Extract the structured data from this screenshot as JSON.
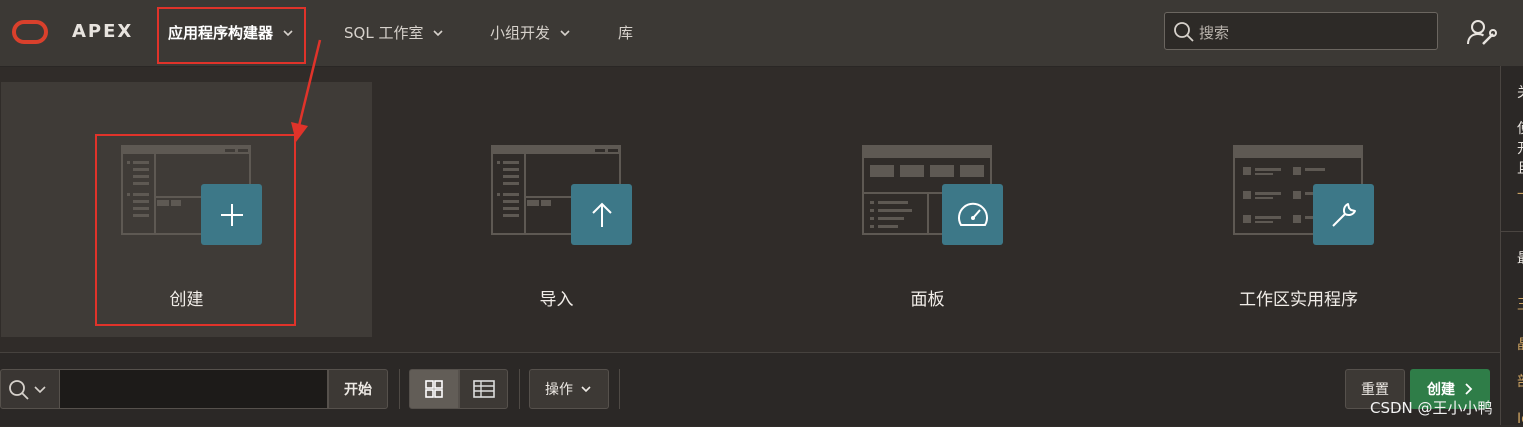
{
  "header": {
    "brand": "APEX",
    "nav": [
      {
        "label": "应用程序构建器",
        "active": true,
        "has_menu": true
      },
      {
        "label": "SQL 工作室",
        "active": false,
        "has_menu": true
      },
      {
        "label": "小组开发",
        "active": false,
        "has_menu": true
      },
      {
        "label": "库",
        "active": false,
        "has_menu": false
      }
    ],
    "search_placeholder": "搜索",
    "logo_color": "#d9402c"
  },
  "cards": [
    {
      "label": "创建",
      "icon": "plus-icon",
      "selected": true
    },
    {
      "label": "导入",
      "icon": "upload-arrow-icon",
      "selected": false
    },
    {
      "label": "面板",
      "icon": "dashboard-gauge-icon",
      "selected": false
    },
    {
      "label": "工作区实用程序",
      "icon": "wrench-icon",
      "selected": false
    }
  ],
  "toolbar": {
    "search_value": "",
    "go_label": "开始",
    "actions_label": "操作",
    "reset_label": "重置",
    "create_label": "创建",
    "create_color": "#2f7d48"
  },
  "watermark": "CSDN @王小小鸭",
  "accent_color": "#3d7888",
  "annotation_color": "#e0332a"
}
